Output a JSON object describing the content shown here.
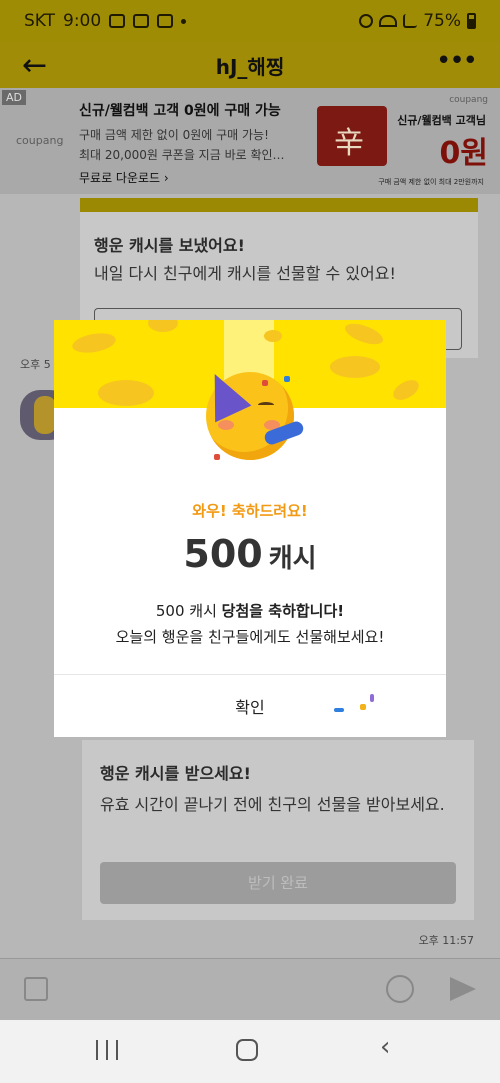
{
  "status_bar": {
    "carrier": "SKT",
    "time": "9:00",
    "battery": "75%"
  },
  "header": {
    "title": "hJ_해찡",
    "back_icon": "back-arrow-icon",
    "more_icon": "more-vertical-icon"
  },
  "ad": {
    "tag": "AD",
    "brand": "coupang",
    "headline": "신규/웰컴백 고객 0원에 구매 가능",
    "desc1": "구매 금액 제한 없이 0원에 구매 가능!",
    "desc2": "최대 20,000원 쿠폰을 지금 바로 확인…",
    "download": "무료로 다운로드 ›",
    "right_brand": "coupang",
    "right_title": "신규/웰컴백 고객님",
    "price": "0원",
    "footnote": "구매 금액 제한 없이 최대 2만원까지"
  },
  "chat": {
    "card1_title": "행운 캐시를 보냈어요!",
    "card1_sub": "내일 다시 친구에게 캐시를 선물할 수 있어요!",
    "time_left": "오후 5",
    "card2_title": "행운 캐시를 받으세요!",
    "card2_sub": "유효 시간이 끝나기 전에 친구의 선물을 받아보세요.",
    "card2_button": "받기 완료",
    "time_right": "오후 11:57"
  },
  "modal": {
    "congrats": "와우! 축하드려요!",
    "amount": "500",
    "unit": "캐시",
    "msg1_prefix": "500 캐시 ",
    "msg1_bold": "당첨을 축하합니다!",
    "msg2": "오늘의 행운을 친구들에게도 선물해보세요!",
    "ok_label": "확인"
  },
  "colors": {
    "accent_yellow": "#ffe200",
    "congrats_orange": "#f29a13",
    "coin": "#f7c520"
  }
}
